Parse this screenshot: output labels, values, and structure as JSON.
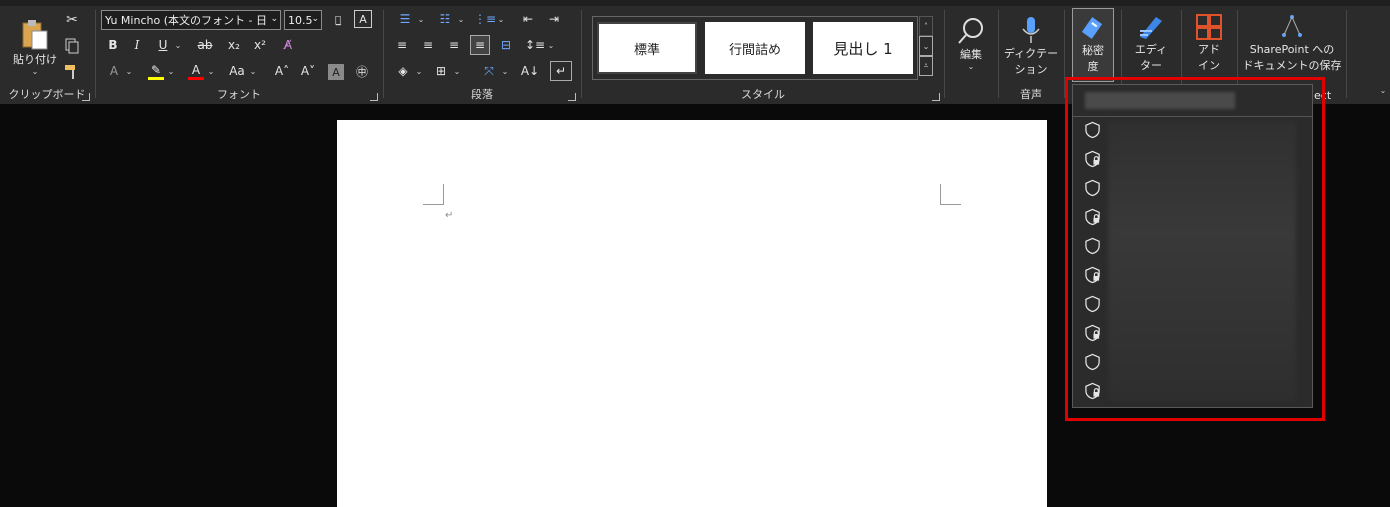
{
  "ribbon": {
    "clipboard": {
      "paste_label": "貼り付け",
      "group_label": "クリップボード"
    },
    "font": {
      "font_name": "Yu Mincho (本文のフォント - 日",
      "font_size": "10.5",
      "bold": "B",
      "italic": "I",
      "underline": "U",
      "strike": "ab",
      "subscript": "x₂",
      "superscript": "x²",
      "case": "Aa",
      "group_label": "フォント"
    },
    "paragraph": {
      "group_label": "段落"
    },
    "styles": {
      "items": [
        "標準",
        "行間詰め",
        "見出し 1"
      ],
      "group_label": "スタイル"
    },
    "editing": {
      "label": "編集"
    },
    "voice": {
      "label_line1": "ディクテー",
      "label_line2": "ション",
      "group_label": "音声"
    },
    "sensitivity": {
      "label_line1": "秘密",
      "label_line2": "度"
    },
    "editor": {
      "label_line1": "エディ",
      "label_line2": "ター"
    },
    "addins": {
      "label_line1": "アド",
      "label_line2": "イン"
    },
    "sharepoint": {
      "label_line1": "SharePoint への",
      "label_line2": "ドキュメントの保存",
      "group_label_partial": "ect"
    }
  },
  "sensitivity_menu": {
    "items": [
      {
        "icon": "shield-icon"
      },
      {
        "icon": "shield-lock-icon"
      },
      {
        "icon": "shield-icon"
      },
      {
        "icon": "shield-lock-icon"
      },
      {
        "icon": "shield-icon"
      },
      {
        "icon": "shield-lock-icon"
      },
      {
        "icon": "shield-icon"
      },
      {
        "icon": "shield-lock-icon"
      },
      {
        "icon": "shield-icon"
      },
      {
        "icon": "shield-lock-icon"
      }
    ]
  },
  "document": {
    "paragraph_mark": "↵"
  },
  "colors": {
    "highlight_frame": "#e00000",
    "ribbon_bg": "#2b2b2b",
    "highlight_yellow": "#ffff00",
    "font_red": "#ff0000"
  }
}
